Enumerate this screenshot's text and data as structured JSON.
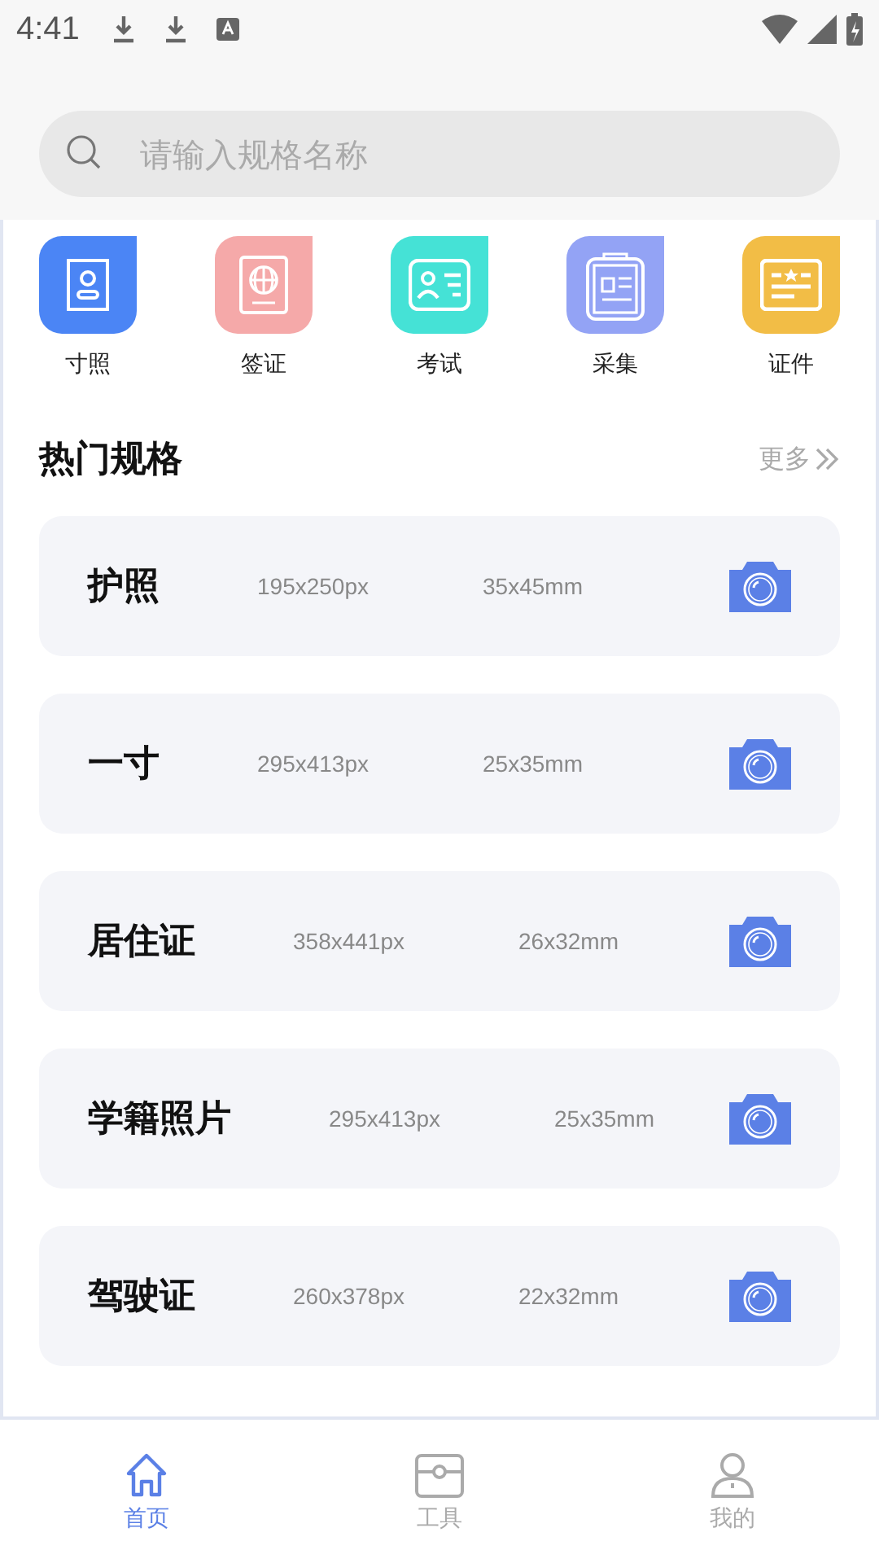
{
  "status_bar": {
    "time": "4:41"
  },
  "search": {
    "placeholder": "请输入规格名称"
  },
  "categories": [
    {
      "label": "寸照",
      "kind": "portrait",
      "color": "#4b85f5"
    },
    {
      "label": "签证",
      "kind": "passport",
      "color": "#f5a9a9"
    },
    {
      "label": "考试",
      "kind": "idcard",
      "color": "#45e2d6"
    },
    {
      "label": "采集",
      "kind": "clipboard",
      "color": "#93a3f5"
    },
    {
      "label": "证件",
      "kind": "certificate",
      "color": "#f2bd46"
    }
  ],
  "section": {
    "title": "热门规格",
    "more": "更多"
  },
  "specs": [
    {
      "name": "护照",
      "pixels": "195x250px",
      "size": "35x45mm"
    },
    {
      "name": "一寸",
      "pixels": "295x413px",
      "size": "25x35mm"
    },
    {
      "name": "居住证",
      "pixels": "358x441px",
      "size": "26x32mm"
    },
    {
      "name": "学籍照片",
      "pixels": "295x413px",
      "size": "25x35mm"
    },
    {
      "name": "驾驶证",
      "pixels": "260x378px",
      "size": "22x32mm"
    }
  ],
  "nav": [
    {
      "label": "首页",
      "kind": "home",
      "selected": true
    },
    {
      "label": "工具",
      "kind": "toolbox",
      "selected": false
    },
    {
      "label": "我的",
      "kind": "person",
      "selected": false
    }
  ]
}
